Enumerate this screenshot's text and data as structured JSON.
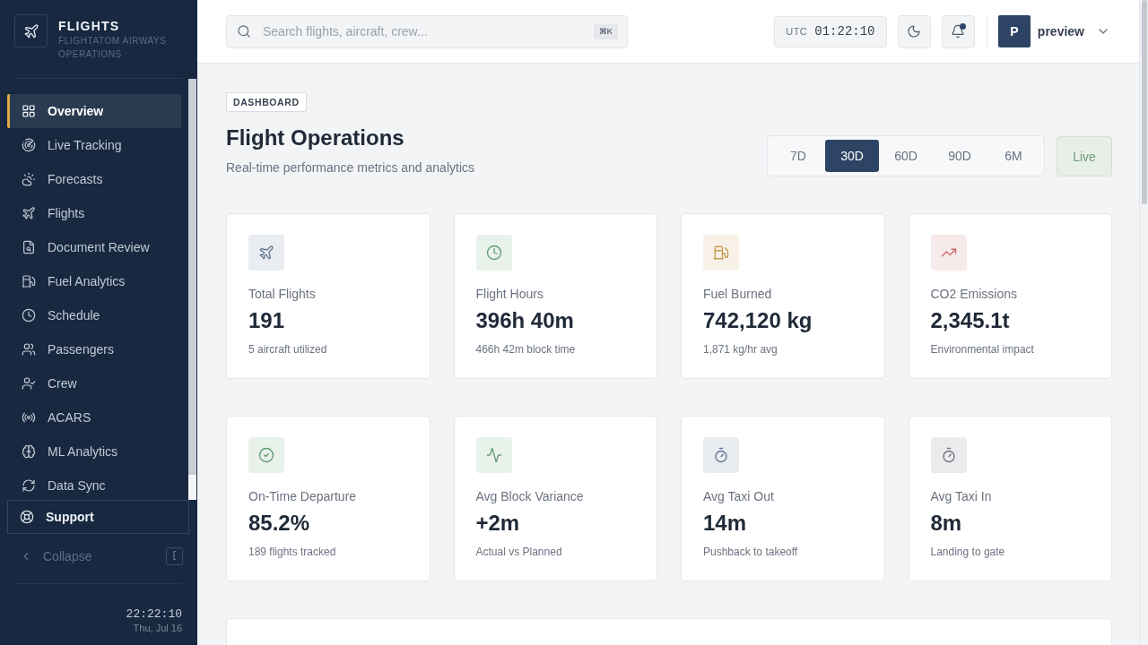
{
  "brand": {
    "title": "FLIGHTS",
    "subtitle": "FLIGHTATOM AIRWAYS OPERATIONS"
  },
  "nav": [
    {
      "label": "Overview",
      "selected": true
    },
    {
      "label": "Live Tracking",
      "selected": false
    },
    {
      "label": "Forecasts",
      "selected": false
    },
    {
      "label": "Flights",
      "selected": false
    },
    {
      "label": "Document Review",
      "selected": false
    },
    {
      "label": "Fuel Analytics",
      "selected": false
    },
    {
      "label": "Schedule",
      "selected": false
    },
    {
      "label": "Passengers",
      "selected": false
    },
    {
      "label": "Crew",
      "selected": false
    },
    {
      "label": "ACARS",
      "selected": false
    },
    {
      "label": "ML Analytics",
      "selected": false
    },
    {
      "label": "Data Sync",
      "selected": false
    }
  ],
  "support": {
    "label": "Support"
  },
  "collapse": {
    "label": "Collapse",
    "shortcut": "["
  },
  "sidebar_clock": {
    "time": "22:22:10",
    "date": "Thu, Jul 16"
  },
  "search": {
    "placeholder": "Search flights, aircraft, crew...",
    "shortcut": "⌘K"
  },
  "utc_clock": {
    "label": "UTC",
    "time": "01:22:10"
  },
  "notifications": {
    "unread": true
  },
  "user": {
    "initial": "P",
    "name": "preview"
  },
  "page": {
    "badge": "DASHBOARD",
    "title": "Flight Operations",
    "subtitle": "Real-time performance metrics and analytics"
  },
  "ranges": [
    {
      "label": "7D",
      "selected": false
    },
    {
      "label": "30D",
      "selected": true
    },
    {
      "label": "60D",
      "selected": false
    },
    {
      "label": "90D",
      "selected": false
    },
    {
      "label": "6M",
      "selected": false
    }
  ],
  "live": {
    "label": "Live"
  },
  "stats": [
    {
      "label": "Total Flights",
      "value": "191",
      "note": "5 aircraft utilized",
      "color": "#e9ecf0"
    },
    {
      "label": "Flight Hours",
      "value": "396h 40m",
      "note": "466h 42m block time",
      "color": "#e9f1eb"
    },
    {
      "label": "Fuel Burned",
      "value": "742,120 kg",
      "note": "1,871 kg/hr avg",
      "color": "#f7f1e7"
    },
    {
      "label": "CO2 Emissions",
      "value": "2,345.1t",
      "note": "Environmental impact",
      "color": "#f7eaea"
    },
    {
      "label": "On-Time Departure",
      "value": "85.2%",
      "note": "189 flights tracked",
      "color": "#e9f1eb"
    },
    {
      "label": "Avg Block Variance",
      "value": "+2m",
      "note": "Actual vs Planned",
      "color": "#e9f1eb"
    },
    {
      "label": "Avg Taxi Out",
      "value": "14m",
      "note": "Pushback to takeoff",
      "color": "#e9ecf0"
    },
    {
      "label": "Avg Taxi In",
      "value": "8m",
      "note": "Landing to gate",
      "color": "#ebebed"
    }
  ]
}
